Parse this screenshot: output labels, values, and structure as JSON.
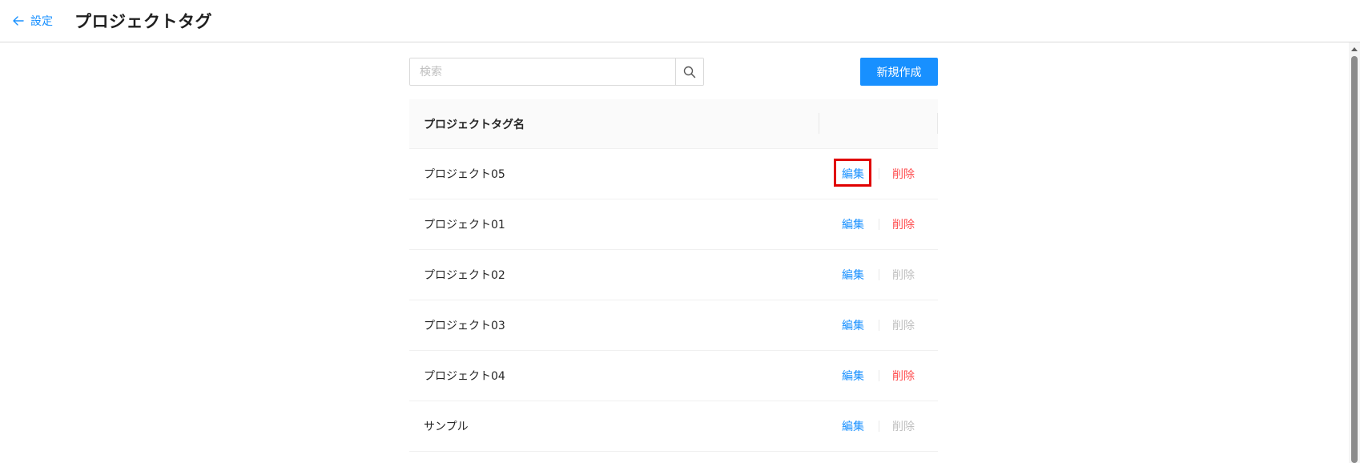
{
  "header": {
    "back_label": "設定",
    "title": "プロジェクトタグ"
  },
  "toolbar": {
    "search_placeholder": "検索",
    "search_value": "",
    "new_label": "新規作成"
  },
  "table": {
    "columns": [
      "プロジェクトタグ名"
    ],
    "rows": [
      {
        "name": "プロジェクト05",
        "edit": "編集",
        "delete": "削除",
        "delete_enabled": true
      },
      {
        "name": "プロジェクト01",
        "edit": "編集",
        "delete": "削除",
        "delete_enabled": true
      },
      {
        "name": "プロジェクト02",
        "edit": "編集",
        "delete": "削除",
        "delete_enabled": false
      },
      {
        "name": "プロジェクト03",
        "edit": "編集",
        "delete": "削除",
        "delete_enabled": false
      },
      {
        "name": "プロジェクト04",
        "edit": "編集",
        "delete": "削除",
        "delete_enabled": true
      },
      {
        "name": "サンプル",
        "edit": "編集",
        "delete": "削除",
        "delete_enabled": false
      }
    ]
  },
  "colors": {
    "accent": "#1890ff",
    "danger": "#ff4d4f",
    "disabled": "#bfbfbf",
    "highlight": "#e00000"
  },
  "icons": {
    "back": "arrow-left-icon",
    "search": "search-icon"
  }
}
